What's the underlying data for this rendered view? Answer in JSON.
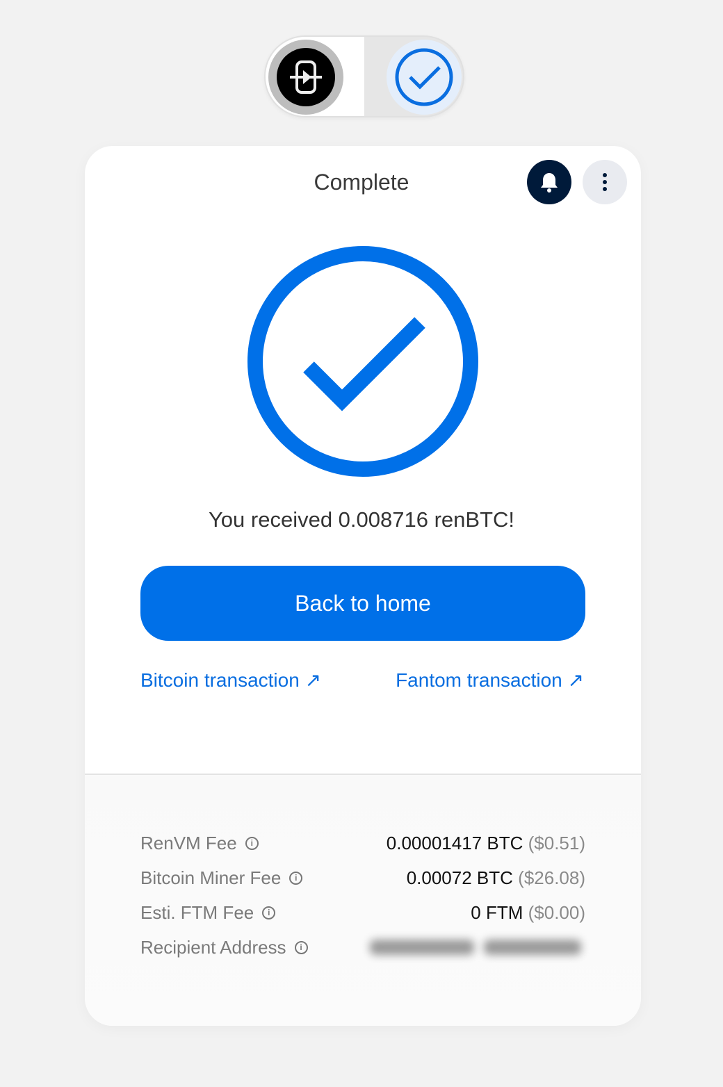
{
  "stepper": {
    "left_icon": "mint-arrow-icon",
    "right_icon": "check-circle-icon",
    "active": "right"
  },
  "header": {
    "title": "Complete",
    "bell_icon": "bell-icon",
    "more_icon": "more-vertical-icon"
  },
  "status": {
    "icon": "large-check-circle-icon",
    "message": "You received 0.008716 renBTC!"
  },
  "actions": {
    "home_label": "Back to home",
    "bitcoin_tx_label": "Bitcoin transaction ↗",
    "fantom_tx_label": "Fantom transaction ↗"
  },
  "fees": [
    {
      "label": "RenVM Fee",
      "value": "0.00001417 BTC",
      "usd": "($0.51)"
    },
    {
      "label": "Bitcoin Miner Fee",
      "value": "0.00072 BTC",
      "usd": "($26.08)"
    },
    {
      "label": "Esti. FTM Fee",
      "value": "0 FTM",
      "usd": "($0.00)"
    },
    {
      "label": "Recipient Address",
      "value": "",
      "usd": ""
    }
  ],
  "colors": {
    "accent": "#0070e8",
    "bell_bg": "#001a3a",
    "background": "#f2f2f2"
  }
}
